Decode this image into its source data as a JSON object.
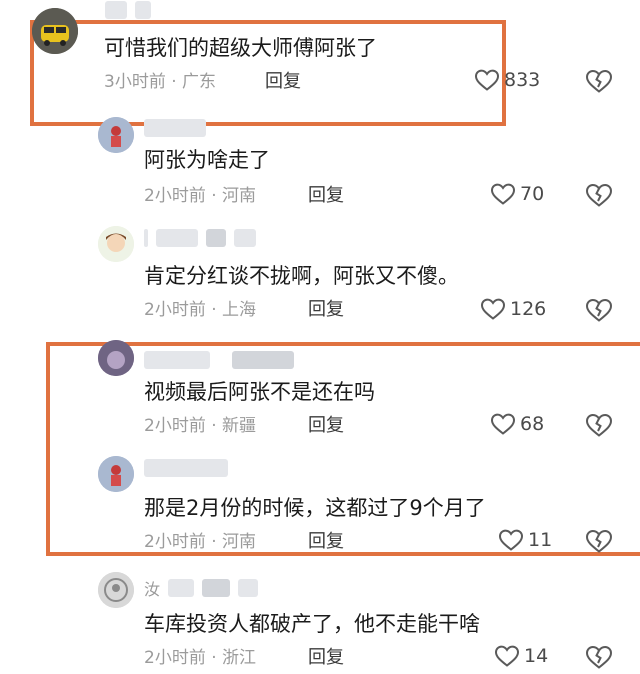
{
  "comments": [
    {
      "name_char": "",
      "text": "可惜我们的超级大师傅阿张了",
      "time": "3小时前",
      "location": "广东",
      "reply": "回复",
      "likes": "833"
    },
    {
      "name_char": "",
      "text": "阿张为啥走了",
      "time": "2小时前",
      "location": "河南",
      "reply": "回复",
      "likes": "70"
    },
    {
      "name_char": "",
      "text": "肯定分红谈不拢啊，阿张又不傻。",
      "time": "2小时前",
      "location": "上海",
      "reply": "回复",
      "likes": "126"
    },
    {
      "name_char": "",
      "text": "视频最后阿张不是还在吗",
      "time": "2小时前",
      "location": "新疆",
      "reply": "回复",
      "likes": "68"
    },
    {
      "name_char": "",
      "text": "那是2月份的时候，这都过了9个月了",
      "time": "2小时前",
      "location": "河南",
      "reply": "回复",
      "likes": "11"
    },
    {
      "name_char": "汝",
      "text": "车库投资人都破产了，他不走能干啥",
      "time": "2小时前",
      "location": "浙江",
      "reply": "回复",
      "likes": "14"
    }
  ],
  "meta_separator": "·",
  "colors": {
    "highlight": "#e07240",
    "meta": "#9b9b9b"
  }
}
